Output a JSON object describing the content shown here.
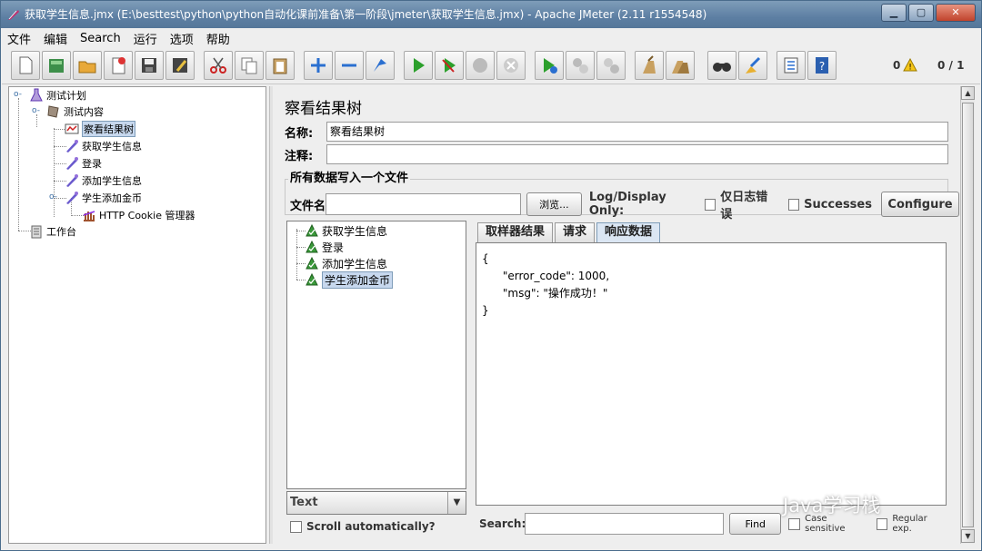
{
  "window": {
    "title": "获取学生信息.jmx (E:\\besttest\\python\\python自动化课前准备\\第一阶段\\jmeter\\获取学生信息.jmx) - Apache JMeter (2.11 r1554548)",
    "min_label": "▁",
    "max_label": "▢",
    "close_label": "✕"
  },
  "menu": [
    "文件",
    "编辑",
    "Search",
    "运行",
    "选项",
    "帮助"
  ],
  "toolbar": {
    "warn_count": "0",
    "thread_count": "0 / 1",
    "icons": [
      "new-icon",
      "templates-icon",
      "open-icon",
      "close-file-icon",
      "save-icon",
      "save-as-icon",
      "cut-icon",
      "copy-icon",
      "paste-icon",
      "expand-icon",
      "collapse-icon",
      "toggle-icon",
      "start-icon",
      "start-no-pause-icon",
      "stop-icon",
      "shutdown-icon",
      "remote-start-icon",
      "remote-stop-icon",
      "remote-shutdown-icon",
      "clear-icon",
      "clear-all-icon",
      "search-icon",
      "reset-search-icon",
      "function-helper-icon",
      "help-icon"
    ]
  },
  "tree": {
    "items": [
      {
        "label": "测试计划",
        "icon": "test-plan-icon"
      },
      {
        "label": "测试内容",
        "icon": "thread-group-icon"
      },
      {
        "label": "察看结果树",
        "icon": "listener-icon"
      },
      {
        "label": "获取学生信息",
        "icon": "sampler-icon"
      },
      {
        "label": "登录",
        "icon": "sampler-icon"
      },
      {
        "label": "添加学生信息",
        "icon": "sampler-icon"
      },
      {
        "label": "学生添加金币",
        "icon": "sampler-icon"
      },
      {
        "label": "HTTP Cookie 管理器",
        "icon": "config-icon"
      },
      {
        "label": "工作台",
        "icon": "workbench-icon"
      }
    ]
  },
  "panel": {
    "title": "察看结果树",
    "name_label": "名称:",
    "name_value": "察看结果树",
    "comment_label": "注释:",
    "comment_value": "",
    "group_title": "所有数据写入一个文件",
    "filename_label": "文件名",
    "filename_value": "",
    "browse_label": "浏览...",
    "logdisplay_label": "Log/Display Only:",
    "errors_label": "仅日志错误",
    "successes_label": "Successes",
    "configure_label": "Configure"
  },
  "results": {
    "items": [
      "获取学生信息",
      "登录",
      "添加学生信息",
      "学生添加金币"
    ],
    "renderer": "Text",
    "scroll_label": "Scroll automatically?"
  },
  "tabs": [
    "取样器结果",
    "请求",
    "响应数据"
  ],
  "response": {
    "text": "{\n      \"error_code\": 1000,\n      \"msg\": \"操作成功！\"\n}"
  },
  "search": {
    "label": "Search:",
    "value": "",
    "find_label": "Find",
    "case_label": "Case sensitive",
    "regex_label": "Regular exp."
  },
  "watermark": "Java学习栈"
}
